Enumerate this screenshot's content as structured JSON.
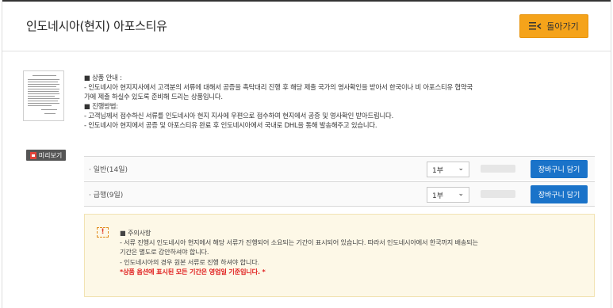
{
  "header": {
    "title": "인도네시아(현지) 아포스티유",
    "back_label": "돌아가기",
    "back_icon": "list-back-icon",
    "accent_color": "#f5a31a"
  },
  "preview": {
    "label": "미리보기",
    "icon": "pdf-icon"
  },
  "description": {
    "lines": [
      "■ 상품 안내 :",
      "- 인도네시아 현지지사에서 고객분의 서류에 대해서 공증을 촉탁대리 진행 후 해당 제출 국가의 영사확인을 받아서 한국이나 비 아포스티유 협약국",
      "가에 제출 하실수 있도록 준비해 드리는 상품입니다.",
      "■ 진행방법:",
      "- 고객님께서 접수하신 서류를 인도네시아 현지 지사에 우편으로 접수하여 현지에서 공증 및 영사확인 받아드립니다.",
      "- 인도네시아 현지에서 공증 및 아포스티유 완료 후 인도네시아에서 국내로 DHL을 통해 발송해주고 있습니다."
    ]
  },
  "options": [
    {
      "label": "· 일반(14일)",
      "qty": "1부",
      "cart_label": "장바구니 담기"
    },
    {
      "label": "· 급행(9일)",
      "qty": "1부",
      "cart_label": "장바구니 담기"
    }
  ],
  "notice": {
    "icon_text": "!",
    "lines": [
      "■ 주의사항",
      "- 서류 진행시 인도네시아 현지에서 해당 서류가 진행되어 소요되는 기간이 표시되어 있습니다. 따라서 인도네시아에서 한국까지 배송되는",
      "기간은 별도로 감안하셔야 합니다.",
      "- 인도네시아의 경우 원본 서류로 진행 하셔야 합니다."
    ],
    "warning": "*상품 옵션에 표시된 모든 기간은 영업일 기준입니다. *"
  }
}
